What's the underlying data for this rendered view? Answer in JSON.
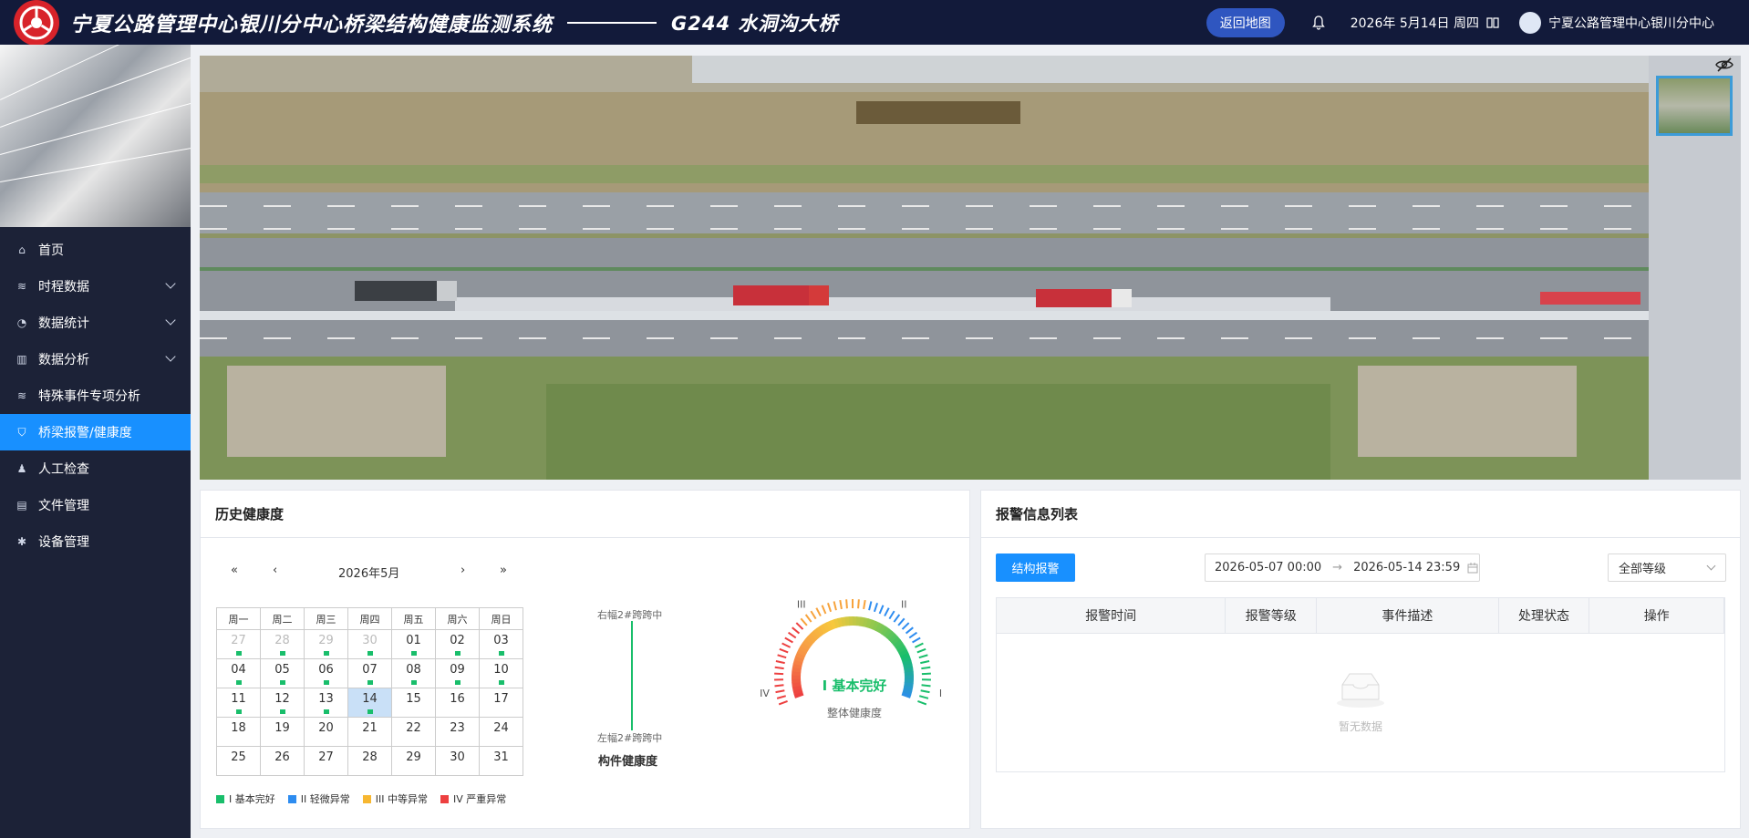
{
  "header": {
    "system_title": "宁夏公路管理中心银川分中心桥梁结构健康监测系统",
    "bridge_title": "G244  水洞沟大桥",
    "back_button": "返回地图",
    "date": "2026年 5月14日 周四",
    "user": "宁夏公路管理中心银川分中心"
  },
  "sidebar": {
    "items": [
      {
        "label": "首页",
        "icon": "home-icon",
        "glyph": "⌂"
      },
      {
        "label": "时程数据",
        "icon": "layers-icon",
        "glyph": "≋"
      },
      {
        "label": "数据统计",
        "icon": "pie-chart-icon",
        "glyph": "◔"
      },
      {
        "label": "数据分析",
        "icon": "bar-chart-icon",
        "glyph": "▥"
      },
      {
        "label": "特殊事件专项分析",
        "icon": "layers-icon",
        "glyph": "≋"
      },
      {
        "label": "桥梁报警/健康度",
        "icon": "shield-icon",
        "glyph": "⛉"
      },
      {
        "label": "人工检查",
        "icon": "user-icon",
        "glyph": "♟"
      },
      {
        "label": "文件管理",
        "icon": "folder-icon",
        "glyph": "▤"
      },
      {
        "label": "设备管理",
        "icon": "tools-icon",
        "glyph": "✱"
      }
    ]
  },
  "history": {
    "title": "历史健康度",
    "nav_prev_year": "«",
    "nav_prev_month": "‹",
    "month": "2026年5月",
    "nav_next_month": "›",
    "nav_next_year": "»",
    "weekdays": [
      "周一",
      "周二",
      "周三",
      "周四",
      "周五",
      "周六",
      "周日"
    ],
    "weeks": [
      [
        {
          "d": "27",
          "prev": true,
          "dot": true
        },
        {
          "d": "28",
          "prev": true,
          "dot": true
        },
        {
          "d": "29",
          "prev": true,
          "dot": true
        },
        {
          "d": "30",
          "prev": true,
          "dot": true
        },
        {
          "d": "01",
          "dot": true
        },
        {
          "d": "02",
          "dot": true
        },
        {
          "d": "03",
          "dot": true
        }
      ],
      [
        {
          "d": "04",
          "dot": true
        },
        {
          "d": "05",
          "dot": true
        },
        {
          "d": "06",
          "dot": true
        },
        {
          "d": "07",
          "dot": true
        },
        {
          "d": "08",
          "dot": true
        },
        {
          "d": "09",
          "dot": true
        },
        {
          "d": "10",
          "dot": true
        }
      ],
      [
        {
          "d": "11",
          "dot": true
        },
        {
          "d": "12",
          "dot": true
        },
        {
          "d": "13",
          "dot": true
        },
        {
          "d": "14",
          "dot": true,
          "today": true
        },
        {
          "d": "15"
        },
        {
          "d": "16"
        },
        {
          "d": "17"
        }
      ],
      [
        {
          "d": "18"
        },
        {
          "d": "19"
        },
        {
          "d": "20"
        },
        {
          "d": "21"
        },
        {
          "d": "22"
        },
        {
          "d": "23"
        },
        {
          "d": "24"
        }
      ],
      [
        {
          "d": "25"
        },
        {
          "d": "26"
        },
        {
          "d": "27"
        },
        {
          "d": "28"
        },
        {
          "d": "29"
        },
        {
          "d": "30"
        },
        {
          "d": "31"
        }
      ]
    ],
    "legend": [
      {
        "label": "I 基本完好",
        "color": "#19be6b"
      },
      {
        "label": "II 轻微异常",
        "color": "#2d8cf0"
      },
      {
        "label": "III 中等异常",
        "color": "#f7b731"
      },
      {
        "label": "IV 严重异常",
        "color": "#ed4040"
      }
    ],
    "component_top": "右幅2#跨跨中",
    "component_bottom": "左幅2#跨跨中",
    "component_label": "构件健康度",
    "gauge": {
      "grade_value": "I 基本完好",
      "caption": "整体健康度",
      "tick_labels": [
        "IV",
        "III",
        "II",
        "I"
      ]
    }
  },
  "alarm": {
    "title": "报警信息列表",
    "tab_button": "结构报警",
    "date_start": "2026-05-07 00:00",
    "date_sep": "→",
    "date_end": "2026-05-14 23:59",
    "level_select": "全部等级",
    "columns": [
      "报警时间",
      "报警等级",
      "事件描述",
      "处理状态",
      "操作"
    ],
    "empty_text": "暂无数据"
  },
  "colors": {
    "header_bg": "#121a3a",
    "sidebar_bg": "#1c2237",
    "accent": "#1890ff",
    "good": "#19be6b"
  }
}
